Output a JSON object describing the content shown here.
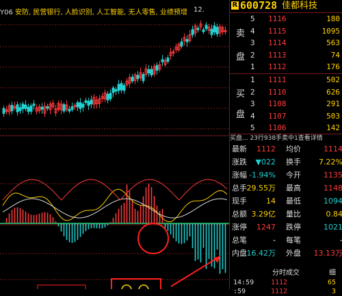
{
  "ticker": {
    "prefix": "Y06",
    "text": "安防, 民营银行, 人脸识别, 人工智能, 无人零售, 业绩预增",
    "peak_label": "12."
  },
  "stock": {
    "badge": "R",
    "code": "600728",
    "name": "佳都科技"
  },
  "orderbook": {
    "sell_side_label": [
      "卖",
      "盘"
    ],
    "buy_side_label": [
      "买",
      "盘"
    ],
    "asks": [
      {
        "n": "5",
        "price": "1116",
        "vol": "180"
      },
      {
        "n": "4",
        "price": "1115",
        "vol": "1095"
      },
      {
        "n": "3",
        "price": "1114",
        "vol": "563"
      },
      {
        "n": "2",
        "price": "1113",
        "vol": "74"
      },
      {
        "n": "1",
        "price": "1112",
        "vol": "176"
      }
    ],
    "bids": [
      {
        "n": "1",
        "price": "1111",
        "vol": "502"
      },
      {
        "n": "2",
        "price": "1110",
        "vol": "626"
      },
      {
        "n": "3",
        "price": "1108",
        "vol": "291"
      },
      {
        "n": "4",
        "price": "1107",
        "vol": "503"
      },
      {
        "n": "5",
        "price": "1106",
        "vol": "142"
      }
    ]
  },
  "subheader": "买盘... 23行938手卖中1查看详情",
  "quote": [
    {
      "l": "最新",
      "v1": "1112",
      "c1": "red",
      "l2": "均价",
      "v2": "1114",
      "c2": "red"
    },
    {
      "l": "涨跌",
      "v1": "▼022",
      "c1": "green",
      "l2": "换手",
      "v2": "7.22%",
      "c2": "yellow"
    },
    {
      "l": "涨幅",
      "v1": "-1.94%",
      "c1": "green",
      "l2": "今开",
      "v2": "1135",
      "c2": "red"
    },
    {
      "l": "总手",
      "v1": "29.55万",
      "c1": "yellow",
      "l2": "最高",
      "v2": "1148",
      "c2": "red"
    },
    {
      "l": "现手",
      "v1": "14",
      "c1": "yellow",
      "l2": "最低",
      "v2": "1094",
      "c2": "green"
    },
    {
      "l": "总额",
      "v1": "3.29亿",
      "c1": "yellow",
      "l2": "量比",
      "v2": "0.84",
      "c2": "yellow"
    },
    {
      "l": "涨停",
      "v1": "1247",
      "c1": "red",
      "l2": "跌停",
      "v2": "1021",
      "c2": "green"
    },
    {
      "l": "总笔",
      "v1": "-",
      "c1": "white",
      "l2": "每笔",
      "v2": "-",
      "c2": "white"
    },
    {
      "l": "内盘",
      "v1": "16.42万",
      "c1": "green",
      "l2": "外盘",
      "v2": "13.13万",
      "c2": "red"
    }
  ],
  "trades_header": {
    "title": "分时成交",
    "more": "细"
  },
  "trades": [
    {
      "time": "14:59",
      "price": "1112",
      "vol": "65"
    },
    {
      "time": ":59",
      "price": "1112",
      "vol": "3"
    }
  ],
  "colors": {
    "up": "#ff3b3b",
    "down": "#21d0d0",
    "accent": "#ffd200",
    "grid": "#7a1a1a"
  }
}
